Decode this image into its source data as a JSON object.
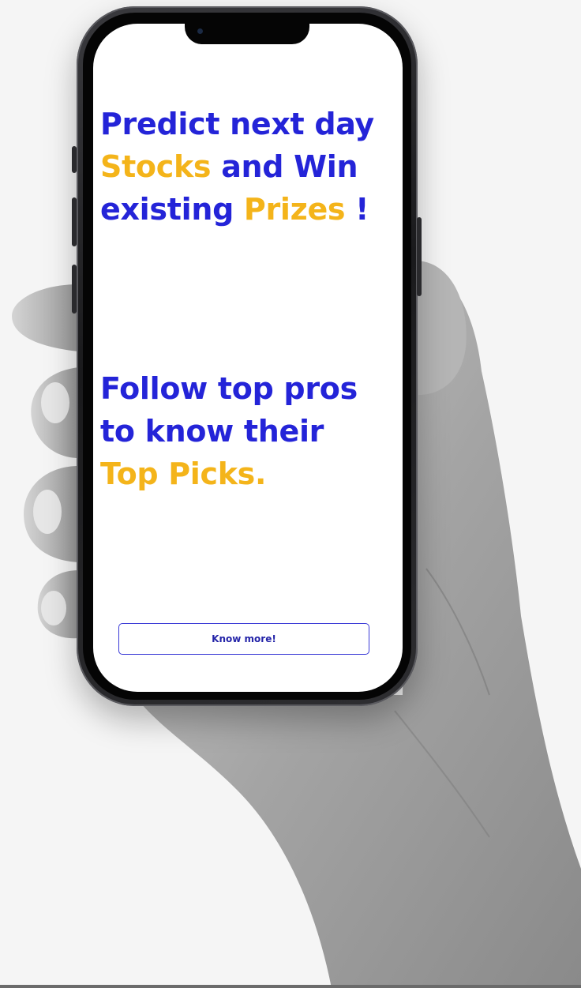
{
  "screen": {
    "headline_1": {
      "line_1": "Predict next day",
      "stocks": "Stocks",
      "and_win": " and Win",
      "existing": "existing ",
      "prizes": "Prizes",
      "exclaim": " !"
    },
    "headline_2": {
      "line_1": "Follow top pros",
      "line_2": "to know their",
      "top_picks": "Top Picks."
    },
    "cta_label": "Know more!"
  },
  "colors": {
    "primary_blue": "#2424d8",
    "accent_yellow": "#f4b41a",
    "background": "#f5f5f5"
  },
  "icons": {
    "hand": "hand-holding-phone",
    "device": "smartphone"
  }
}
